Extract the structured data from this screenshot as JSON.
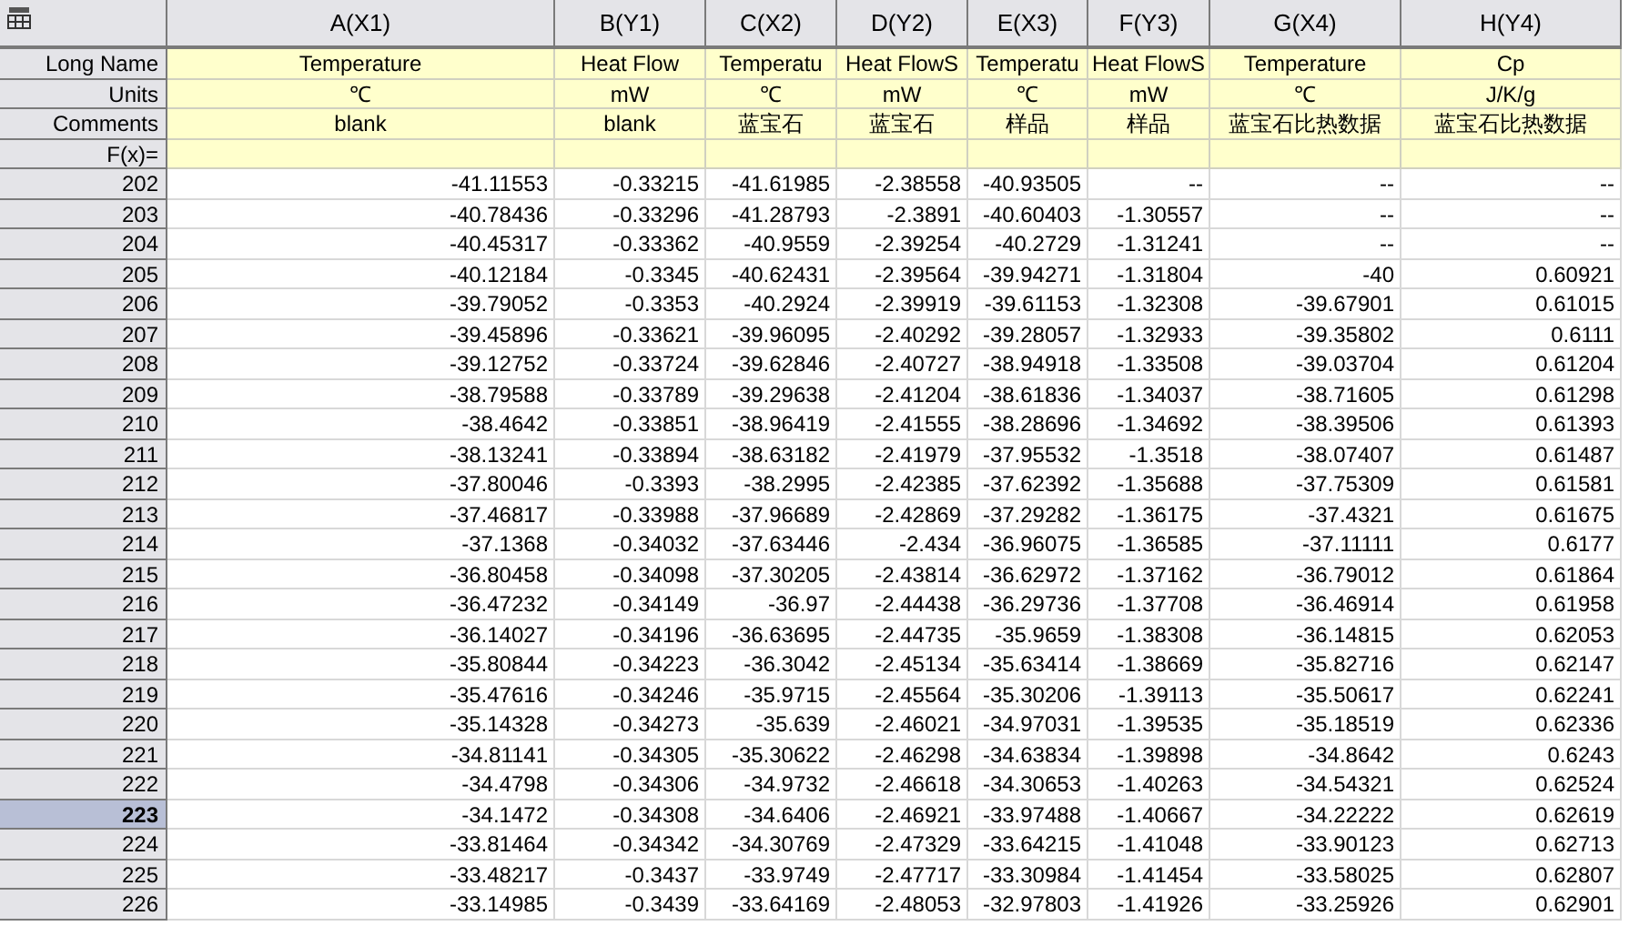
{
  "sheet": {
    "row_labels": [
      "Long Name",
      "Units",
      "Comments",
      "F(x)="
    ],
    "columns": [
      {
        "name": "A(X1)",
        "long_name": "Temperature",
        "units": "℃",
        "comments": "blank"
      },
      {
        "name": "B(Y1)",
        "long_name": "Heat Flow",
        "units": "mW",
        "comments": "blank"
      },
      {
        "name": "C(X2)",
        "long_name": "Temperatu",
        "units": "℃",
        "comments": "蓝宝石"
      },
      {
        "name": "D(Y2)",
        "long_name": "Heat FlowS",
        "units": "mW",
        "comments": "蓝宝石"
      },
      {
        "name": "E(X3)",
        "long_name": "Temperatu",
        "units": "℃",
        "comments": "样品"
      },
      {
        "name": "F(Y3)",
        "long_name": "Heat FlowS",
        "units": "mW",
        "comments": "样品"
      },
      {
        "name": "G(X4)",
        "long_name": "Temperature",
        "units": "℃",
        "comments": "蓝宝石比热数据"
      },
      {
        "name": "H(Y4)",
        "long_name": "Cp",
        "units": "J/K/g",
        "comments": "蓝宝石比热数据"
      }
    ],
    "rows": [
      {
        "label": "202",
        "selected": false,
        "cells": [
          "-41.11553",
          "-0.33215",
          "-41.61985",
          "-2.38558",
          "-40.93505",
          "--",
          "--",
          "--"
        ]
      },
      {
        "label": "203",
        "selected": false,
        "cells": [
          "-40.78436",
          "-0.33296",
          "-41.28793",
          "-2.3891",
          "-40.60403",
          "-1.30557",
          "--",
          "--"
        ]
      },
      {
        "label": "204",
        "selected": false,
        "cells": [
          "-40.45317",
          "-0.33362",
          "-40.9559",
          "-2.39254",
          "-40.2729",
          "-1.31241",
          "--",
          "--"
        ]
      },
      {
        "label": "205",
        "selected": false,
        "cells": [
          "-40.12184",
          "-0.3345",
          "-40.62431",
          "-2.39564",
          "-39.94271",
          "-1.31804",
          "-40",
          "0.60921"
        ]
      },
      {
        "label": "206",
        "selected": false,
        "cells": [
          "-39.79052",
          "-0.3353",
          "-40.2924",
          "-2.39919",
          "-39.61153",
          "-1.32308",
          "-39.67901",
          "0.61015"
        ]
      },
      {
        "label": "207",
        "selected": false,
        "cells": [
          "-39.45896",
          "-0.33621",
          "-39.96095",
          "-2.40292",
          "-39.28057",
          "-1.32933",
          "-39.35802",
          "0.6111"
        ]
      },
      {
        "label": "208",
        "selected": false,
        "cells": [
          "-39.12752",
          "-0.33724",
          "-39.62846",
          "-2.40727",
          "-38.94918",
          "-1.33508",
          "-39.03704",
          "0.61204"
        ]
      },
      {
        "label": "209",
        "selected": false,
        "cells": [
          "-38.79588",
          "-0.33789",
          "-39.29638",
          "-2.41204",
          "-38.61836",
          "-1.34037",
          "-38.71605",
          "0.61298"
        ]
      },
      {
        "label": "210",
        "selected": false,
        "cells": [
          "-38.4642",
          "-0.33851",
          "-38.96419",
          "-2.41555",
          "-38.28696",
          "-1.34692",
          "-38.39506",
          "0.61393"
        ]
      },
      {
        "label": "211",
        "selected": false,
        "cells": [
          "-38.13241",
          "-0.33894",
          "-38.63182",
          "-2.41979",
          "-37.95532",
          "-1.3518",
          "-38.07407",
          "0.61487"
        ]
      },
      {
        "label": "212",
        "selected": false,
        "cells": [
          "-37.80046",
          "-0.3393",
          "-38.2995",
          "-2.42385",
          "-37.62392",
          "-1.35688",
          "-37.75309",
          "0.61581"
        ]
      },
      {
        "label": "213",
        "selected": false,
        "cells": [
          "-37.46817",
          "-0.33988",
          "-37.96689",
          "-2.42869",
          "-37.29282",
          "-1.36175",
          "-37.4321",
          "0.61675"
        ]
      },
      {
        "label": "214",
        "selected": false,
        "cells": [
          "-37.1368",
          "-0.34032",
          "-37.63446",
          "-2.434",
          "-36.96075",
          "-1.36585",
          "-37.11111",
          "0.6177"
        ]
      },
      {
        "label": "215",
        "selected": false,
        "cells": [
          "-36.80458",
          "-0.34098",
          "-37.30205",
          "-2.43814",
          "-36.62972",
          "-1.37162",
          "-36.79012",
          "0.61864"
        ]
      },
      {
        "label": "216",
        "selected": false,
        "cells": [
          "-36.47232",
          "-0.34149",
          "-36.97",
          "-2.44438",
          "-36.29736",
          "-1.37708",
          "-36.46914",
          "0.61958"
        ]
      },
      {
        "label": "217",
        "selected": false,
        "cells": [
          "-36.14027",
          "-0.34196",
          "-36.63695",
          "-2.44735",
          "-35.9659",
          "-1.38308",
          "-36.14815",
          "0.62053"
        ]
      },
      {
        "label": "218",
        "selected": false,
        "cells": [
          "-35.80844",
          "-0.34223",
          "-36.3042",
          "-2.45134",
          "-35.63414",
          "-1.38669",
          "-35.82716",
          "0.62147"
        ]
      },
      {
        "label": "219",
        "selected": false,
        "cells": [
          "-35.47616",
          "-0.34246",
          "-35.9715",
          "-2.45564",
          "-35.30206",
          "-1.39113",
          "-35.50617",
          "0.62241"
        ]
      },
      {
        "label": "220",
        "selected": false,
        "cells": [
          "-35.14328",
          "-0.34273",
          "-35.639",
          "-2.46021",
          "-34.97031",
          "-1.39535",
          "-35.18519",
          "0.62336"
        ]
      },
      {
        "label": "221",
        "selected": false,
        "cells": [
          "-34.81141",
          "-0.34305",
          "-35.30622",
          "-2.46298",
          "-34.63834",
          "-1.39898",
          "-34.8642",
          "0.6243"
        ]
      },
      {
        "label": "222",
        "selected": false,
        "cells": [
          "-34.4798",
          "-0.34306",
          "-34.9732",
          "-2.46618",
          "-34.30653",
          "-1.40263",
          "-34.54321",
          "0.62524"
        ]
      },
      {
        "label": "223",
        "selected": true,
        "cells": [
          "-34.1472",
          "-0.34308",
          "-34.6406",
          "-2.46921",
          "-33.97488",
          "-1.40667",
          "-34.22222",
          "0.62619"
        ]
      },
      {
        "label": "224",
        "selected": false,
        "cells": [
          "-33.81464",
          "-0.34342",
          "-34.30769",
          "-2.47329",
          "-33.64215",
          "-1.41048",
          "-33.90123",
          "0.62713"
        ]
      },
      {
        "label": "225",
        "selected": false,
        "cells": [
          "-33.48217",
          "-0.3437",
          "-33.9749",
          "-2.47717",
          "-33.30984",
          "-1.41454",
          "-33.58025",
          "0.62807"
        ]
      },
      {
        "label": "226",
        "selected": false,
        "cells": [
          "-33.14985",
          "-0.3439",
          "-33.64169",
          "-2.48053",
          "-32.97803",
          "-1.41926",
          "-33.25926",
          "0.62901"
        ]
      }
    ]
  }
}
